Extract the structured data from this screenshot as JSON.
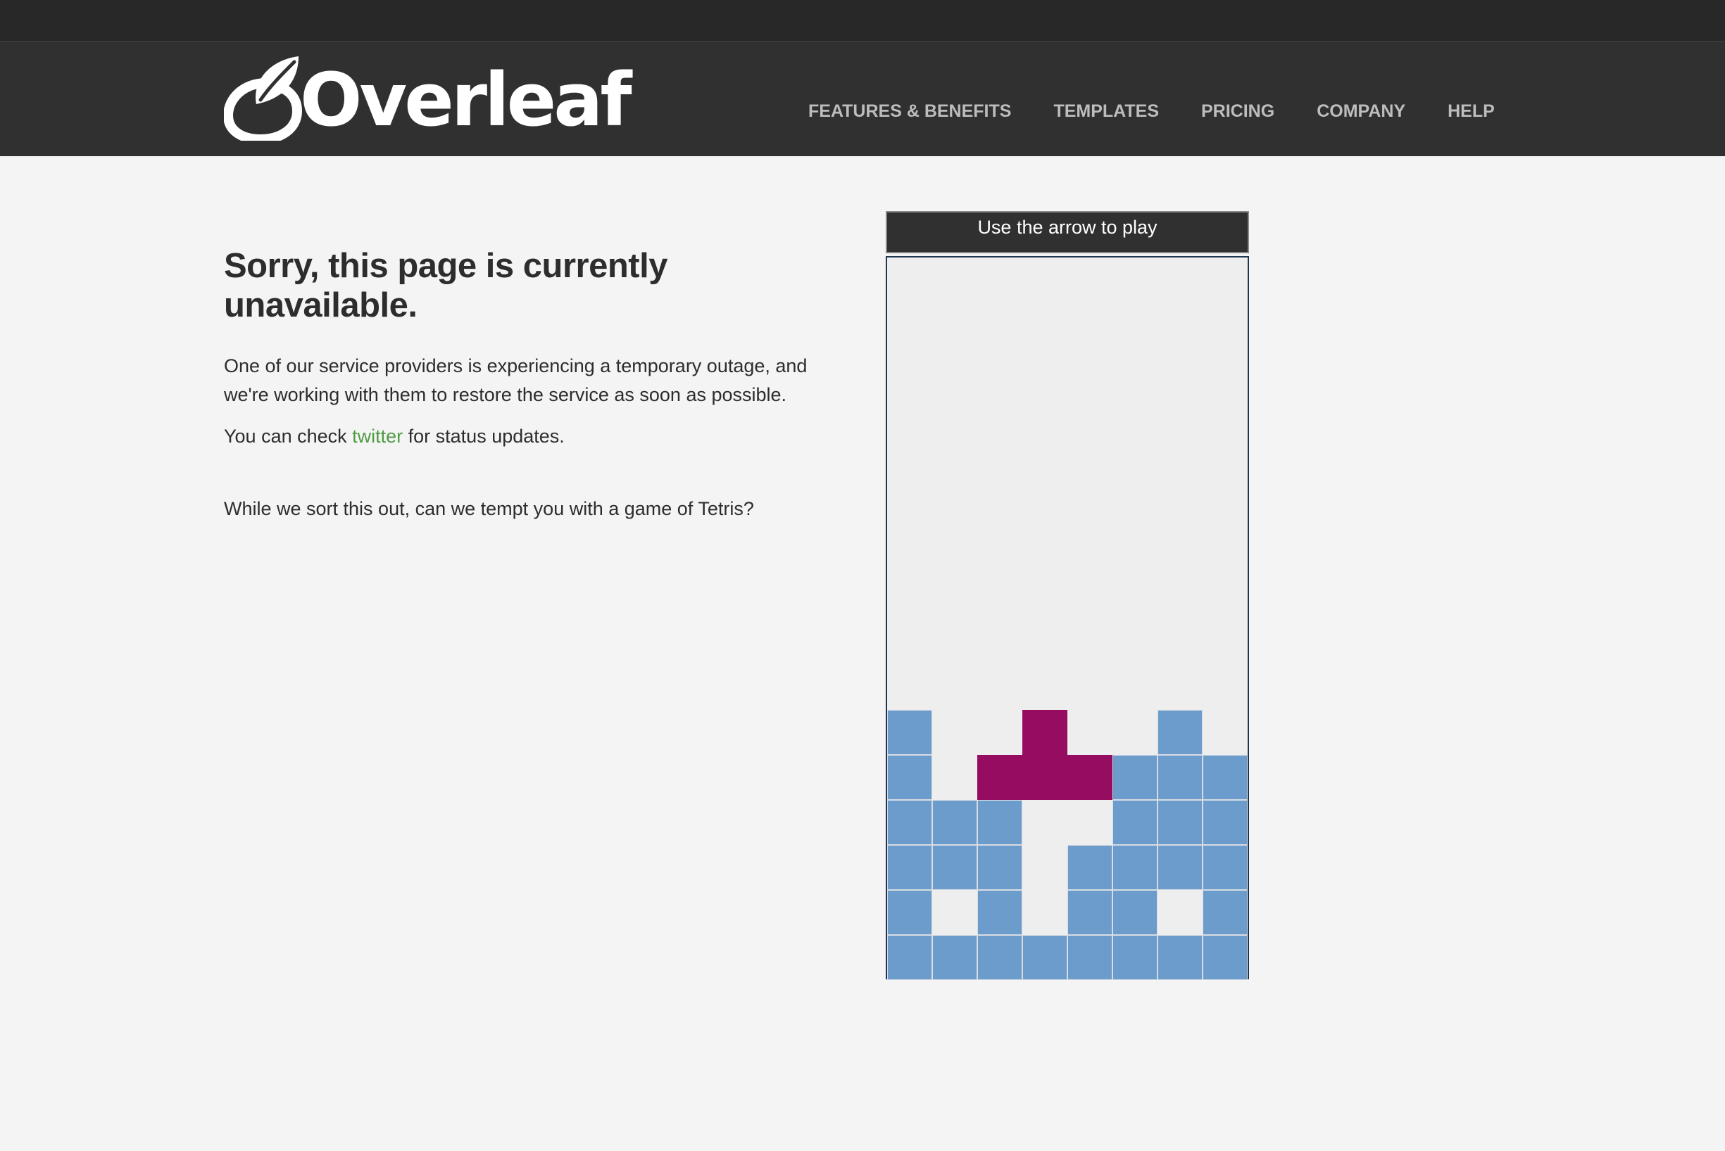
{
  "brand": {
    "name": "Overleaf",
    "logo_icon": "overleaf-logo-icon"
  },
  "nav": {
    "items": [
      {
        "label": "FEATURES & BENEFITS"
      },
      {
        "label": "TEMPLATES"
      },
      {
        "label": "PRICING"
      },
      {
        "label": "COMPANY"
      },
      {
        "label": "HELP"
      }
    ]
  },
  "main": {
    "title": "Sorry, this page is currently unavailable.",
    "outage_text": "One of our service providers is experiencing a temporary outage, and we're working with them to restore the service as soon as possible.",
    "check_prefix": "You can check ",
    "twitter_label": "twitter",
    "check_suffix": " for status updates.",
    "tetris_prompt": "While we sort this out, can we tempt you with a game of Tetris?"
  },
  "game": {
    "header": "Use the arrow to play",
    "columns": 8,
    "rows": 16,
    "colors": {
      "block": "#6b9ccb",
      "active_piece": "#960c61",
      "board": "#eeeeee"
    },
    "board_bottom_rows": [
      "B.PPPBBB",
      "BBB..BBB",
      "BBB.BBBB",
      "B.B.BB.B",
      "BBBBBBBB"
    ],
    "row_above": "B..P..B."
  },
  "colors": {
    "navbar": "#303030",
    "top_strip": "#282828",
    "link": "#4f9c45",
    "page_bg": "#f4f4f4"
  }
}
